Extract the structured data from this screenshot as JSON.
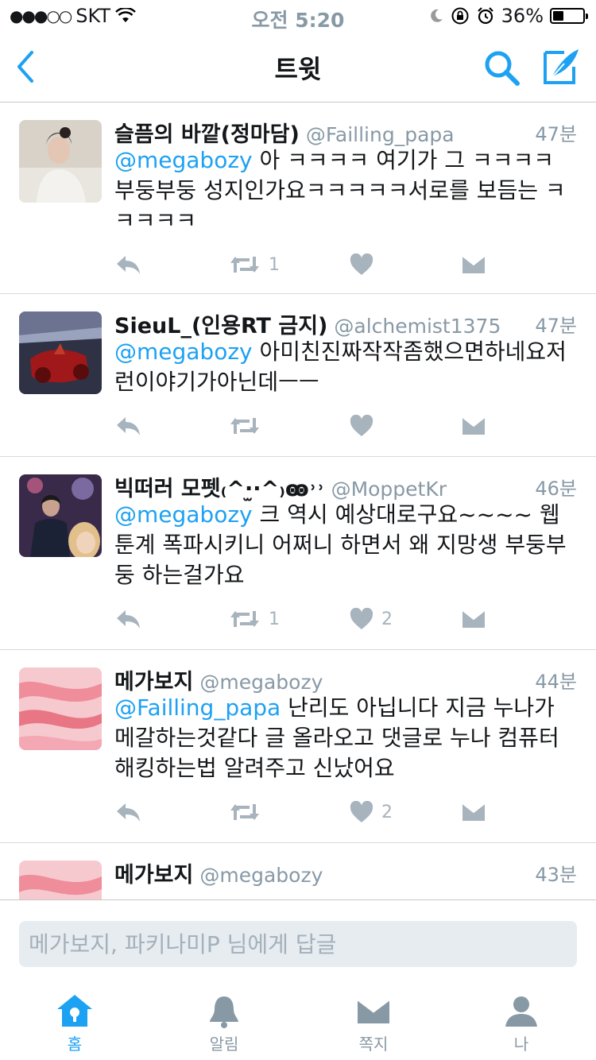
{
  "status_bar": {
    "carrier": "SKT",
    "time": "오전 5:20",
    "battery": "36%",
    "battery_level": 0.36
  },
  "nav": {
    "title": "트윗",
    "icons": [
      "back-chevron-icon",
      "search-icon",
      "compose-quill-icon"
    ],
    "accent": "#1da1f2"
  },
  "tweets": [
    {
      "name": "슬픔의 바깥(정마담)",
      "handle": "@Failling_papa",
      "time": "47분",
      "mention": "@megabozy",
      "text": " 아 ㅋㅋㅋㅋ 여기가 그 ㅋㅋㅋㅋ 부둥부둥 성지인가요ㅋㅋㅋㅋㅋ서로를 보듬는 ㅋㅋㅋㅋㅋ",
      "retweets": "1",
      "likes": ""
    },
    {
      "name": "SieuL_(인용RT 금지)",
      "handle": "@alchemist1375",
      "time": "47분",
      "mention": "@megabozy",
      "text": " 아미친진짜작작좀했으면하네요저런이야기가아닌데ㅡㅡ",
      "retweets": "",
      "likes": ""
    },
    {
      "name": "빅떠러 모펫₍^·̫·^₎ꙭ˒˒",
      "handle": "@MoppetKr",
      "time": "46분",
      "mention": "@megabozy",
      "text": " 크 역시 예상대로구요~~~~ 웹툰계 폭파시키니 어쩌니 하면서 왜 지망생 부둥부둥 하는걸가요",
      "retweets": "1",
      "likes": "2"
    },
    {
      "name": "메가보지",
      "handle": "@megabozy",
      "time": "44분",
      "mention": "@Failling_papa",
      "text": " 난리도 아닙니다 지금 누나가 메갈하는것같다 글 올라오고 댓글로 누나 컴퓨터 해킹하는법 알려주고 신났어요",
      "retweets": "",
      "likes": "2"
    },
    {
      "name": "메가보지",
      "handle": "@megabozy",
      "time": "43분",
      "mention": "",
      "text": "",
      "retweets": "",
      "likes": ""
    }
  ],
  "reply": {
    "placeholder": "메가보지, 파키나미P 님에게 답글"
  },
  "tabs": [
    {
      "label": "홈",
      "icon": "home-icon",
      "active": true
    },
    {
      "label": "알림",
      "icon": "bell-icon",
      "active": false
    },
    {
      "label": "쪽지",
      "icon": "mail-icon",
      "active": false
    },
    {
      "label": "나",
      "icon": "profile-icon",
      "active": false
    }
  ]
}
